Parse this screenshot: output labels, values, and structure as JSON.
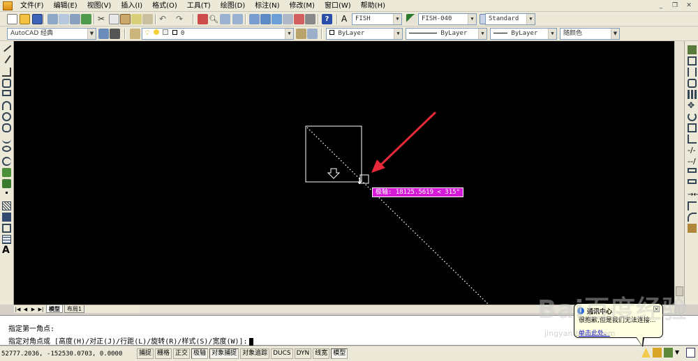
{
  "menu": {
    "items": [
      "文件(F)",
      "编辑(E)",
      "视图(V)",
      "插入(I)",
      "格式(O)",
      "工具(T)",
      "绘图(D)",
      "标注(N)",
      "修改(M)",
      "窗口(W)",
      "帮助(H)"
    ]
  },
  "toolbar": {
    "text_style": "FISH",
    "dim_style": "FISH-040",
    "table_style": "Standard",
    "workspace": "AutoCAD 经典",
    "layer": "0",
    "color": "ByLayer",
    "linetype": "ByLayer",
    "lineweight": "ByLayer",
    "plotstyle": "随颜色"
  },
  "drawing": {
    "tooltip": "极轴: 18125.5619 < 315°"
  },
  "layout_tabs": {
    "nav": [
      "|◀",
      "◀",
      "▶",
      "▶|"
    ],
    "tabs": [
      "模型",
      "布局1"
    ]
  },
  "command": {
    "line1": "指定第一角点:",
    "line2": "指定对角点或 [高度(H)/对正(J)/行距(L)/旋转(R)/样式(S)/宽度(W)]:"
  },
  "status": {
    "coords": "52777.2036, -152530.0703, 0.0000",
    "buttons": [
      "捕捉",
      "栅格",
      "正交",
      "极轴",
      "对象捕捉",
      "对象追踪",
      "DUCS",
      "DYN",
      "线宽",
      "模型"
    ],
    "on_flags": [
      false,
      false,
      false,
      true,
      true,
      false,
      false,
      false,
      false,
      true
    ]
  },
  "balloon": {
    "title": "通讯中心",
    "message": "很抱歉,但是我们无法连接...",
    "link": "单击此处。"
  },
  "watermark": {
    "logo": "Bai百度经验",
    "url": "jingyan.baidu.com"
  },
  "colors": {
    "tooltip_bg": "#d41ad6",
    "arrow": "#e8293a",
    "canvas_bg": "#000000"
  }
}
